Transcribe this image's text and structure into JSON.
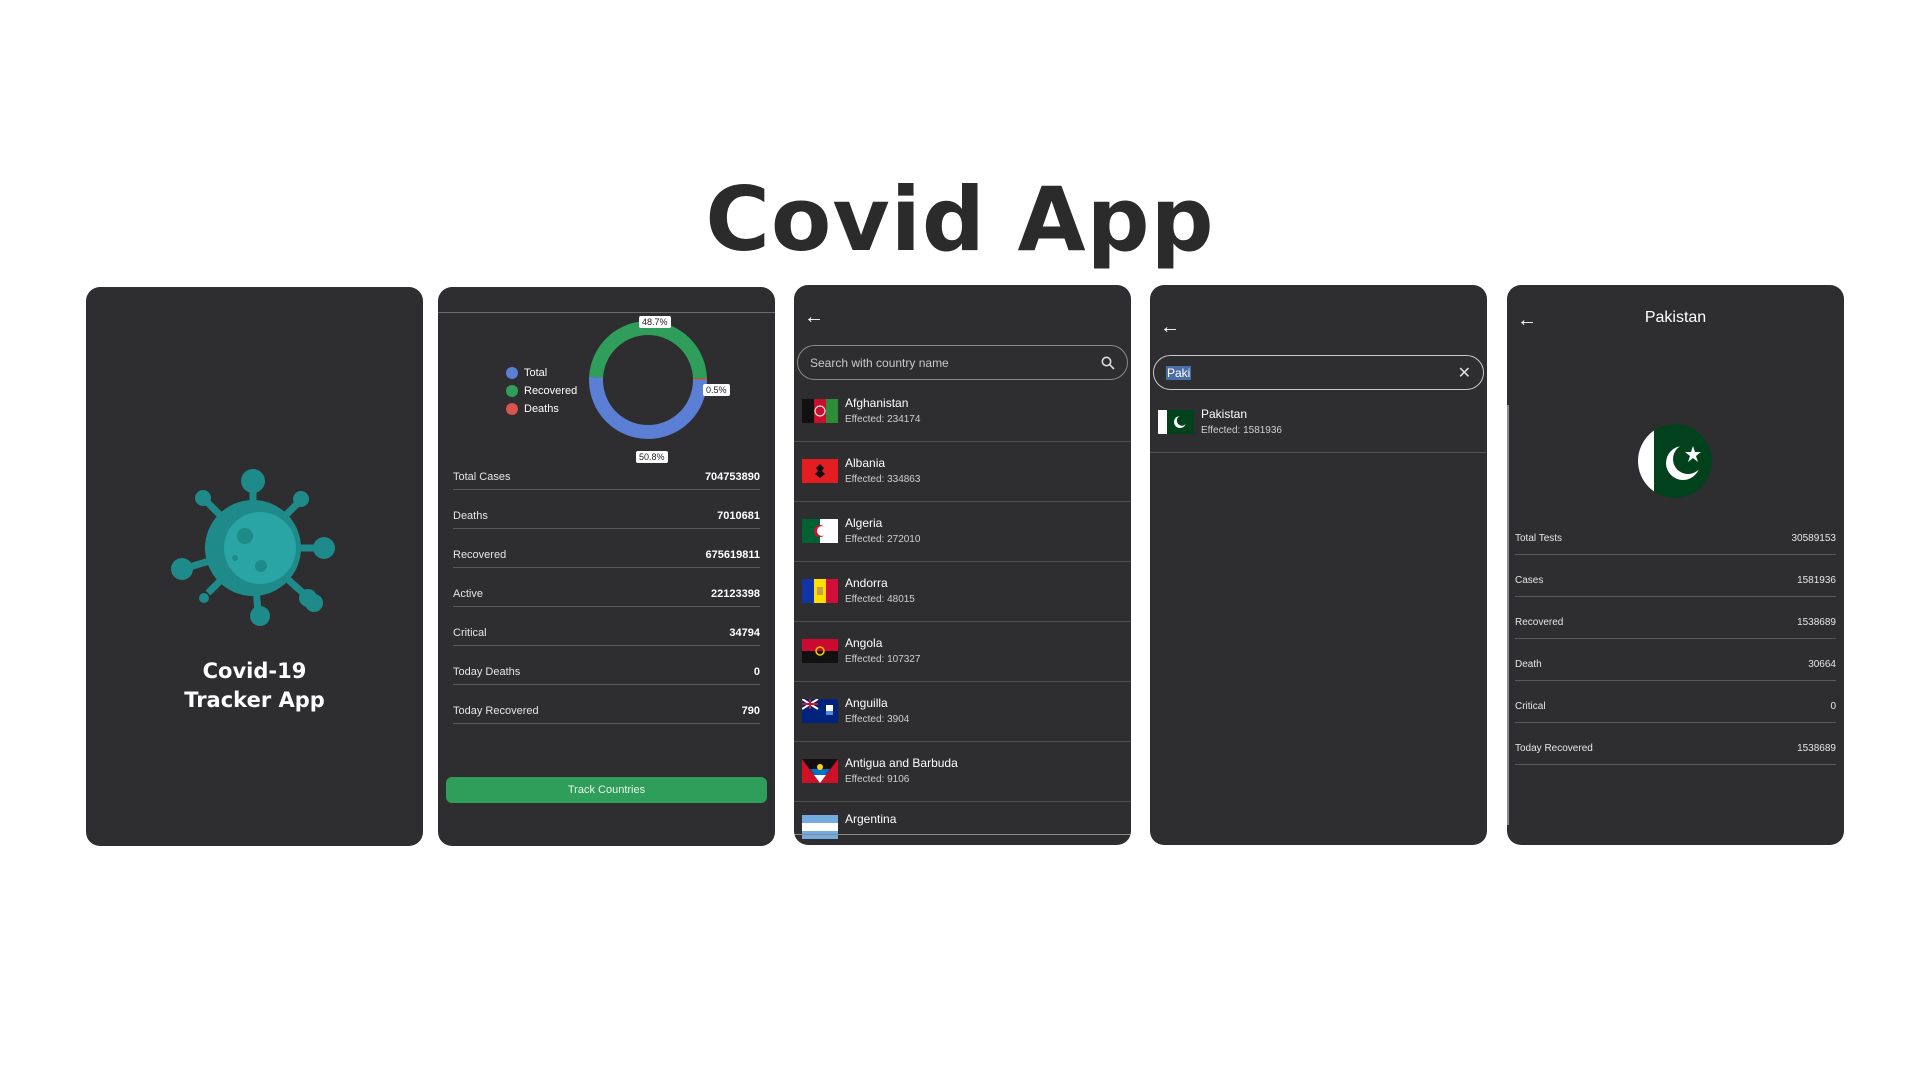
{
  "page": {
    "title": "Covid App"
  },
  "splash": {
    "line1": "Covid-19",
    "line2": "Tracker App",
    "colors": {
      "virus": "#1f8a8a",
      "virus_light": "#2aa5a5"
    }
  },
  "stats": {
    "legend": [
      {
        "label": "Total",
        "color": "#5b7fd4"
      },
      {
        "label": "Recovered",
        "color": "#2f9e5a"
      },
      {
        "label": "Deaths",
        "color": "#d9534f"
      }
    ],
    "chart_data": {
      "type": "pie",
      "categories": [
        "Total",
        "Recovered",
        "Deaths"
      ],
      "values": [
        50.8,
        48.7,
        0.5
      ],
      "labels": [
        "50.8%",
        "48.7%",
        "0.5%"
      ]
    },
    "rows": [
      {
        "label": "Total Cases",
        "value": "704753890"
      },
      {
        "label": "Deaths",
        "value": "7010681"
      },
      {
        "label": "Recovered",
        "value": "675619811"
      },
      {
        "label": "Active",
        "value": "22123398"
      },
      {
        "label": "Critical",
        "value": "34794"
      },
      {
        "label": "Today Deaths",
        "value": "0"
      },
      {
        "label": "Today Recovered",
        "value": "790"
      }
    ],
    "track_button": "Track Countries"
  },
  "countries": {
    "search_placeholder": "Search with country name",
    "items": [
      {
        "name": "Afghanistan",
        "effected": "Effected: 234174"
      },
      {
        "name": "Albania",
        "effected": "Effected: 334863"
      },
      {
        "name": "Algeria",
        "effected": "Effected: 272010"
      },
      {
        "name": "Andorra",
        "effected": "Effected: 48015"
      },
      {
        "name": "Angola",
        "effected": "Effected: 107327"
      },
      {
        "name": "Anguilla",
        "effected": "Effected: 3904"
      },
      {
        "name": "Antigua and Barbuda",
        "effected": "Effected: 9106"
      },
      {
        "name": "Argentina",
        "effected": ""
      }
    ]
  },
  "search_result": {
    "query": "Paki",
    "items": [
      {
        "name": "Pakistan",
        "effected": "Effected: 1581936"
      }
    ]
  },
  "detail": {
    "country": "Pakistan",
    "rows": [
      {
        "label": "Total Tests",
        "value": "30589153"
      },
      {
        "label": "Cases",
        "value": "1581936"
      },
      {
        "label": "Recovered",
        "value": "1538689"
      },
      {
        "label": "Death",
        "value": "30664"
      },
      {
        "label": "Critical",
        "value": "0"
      },
      {
        "label": "Today Recovered",
        "value": "1538689"
      }
    ]
  }
}
